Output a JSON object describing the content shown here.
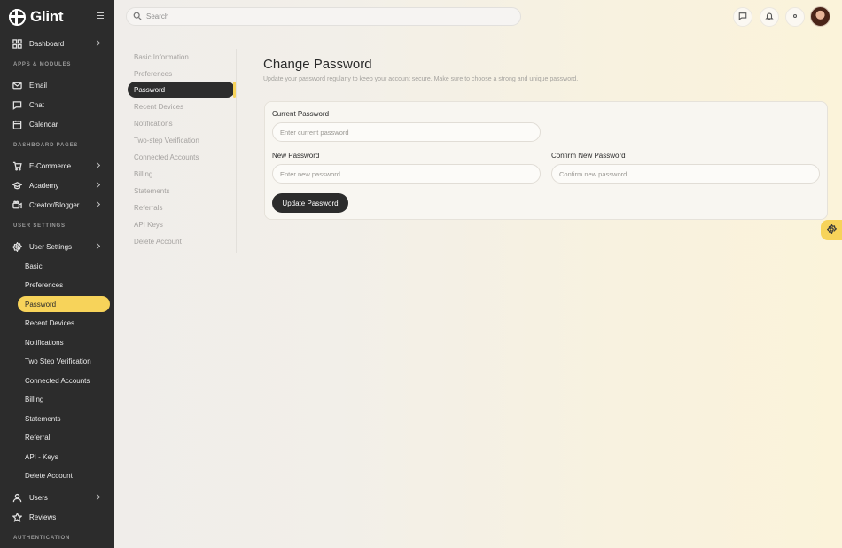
{
  "brand": {
    "name": "Glint"
  },
  "search": {
    "placeholder": "Search"
  },
  "sidebar": {
    "dashboard": "Dashboard",
    "section_apps": "APPS & MODULES",
    "email": "Email",
    "chat": "Chat",
    "calendar": "Calendar",
    "section_dashboard_pages": "DASHBOARD PAGES",
    "ecommerce": "E-Commerce",
    "academy": "Academy",
    "creator": "Creator/Blogger",
    "section_user_settings": "USER SETTINGS",
    "user_settings": "User Settings",
    "sub_items": [
      "Basic",
      "Preferences",
      "Password",
      "Recent Devices",
      "Notifications",
      "Two Step Verification",
      "Connected Accounts",
      "Billing",
      "Statements",
      "Referral",
      "API - Keys",
      "Delete Account"
    ],
    "active_sub": "Password",
    "users": "Users",
    "reviews": "Reviews",
    "section_authentication": "AUTHENTICATION"
  },
  "settings_menu": {
    "items": [
      "Basic Information",
      "Preferences",
      "Password",
      "Recent Devices",
      "Notifications",
      "Two-step Verification",
      "Connected Accounts",
      "Billing",
      "Statements",
      "Referrals",
      "API Keys",
      "Delete Account"
    ],
    "active": "Password"
  },
  "main": {
    "title": "Change Password",
    "subtitle": "Update your password regularly to keep your account secure. Make sure to choose a strong and unique password.",
    "current_label": "Current Password",
    "current_placeholder": "Enter current password",
    "new_label": "New Password",
    "new_placeholder": "Enter new password",
    "confirm_label": "Confirm New Password",
    "confirm_placeholder": "Confirm new password",
    "update_button": "Update Password"
  },
  "colors": {
    "accent": "#f7d35a",
    "sidebar_bg": "#2c2c2c",
    "dark_button": "#2c2c2c"
  }
}
